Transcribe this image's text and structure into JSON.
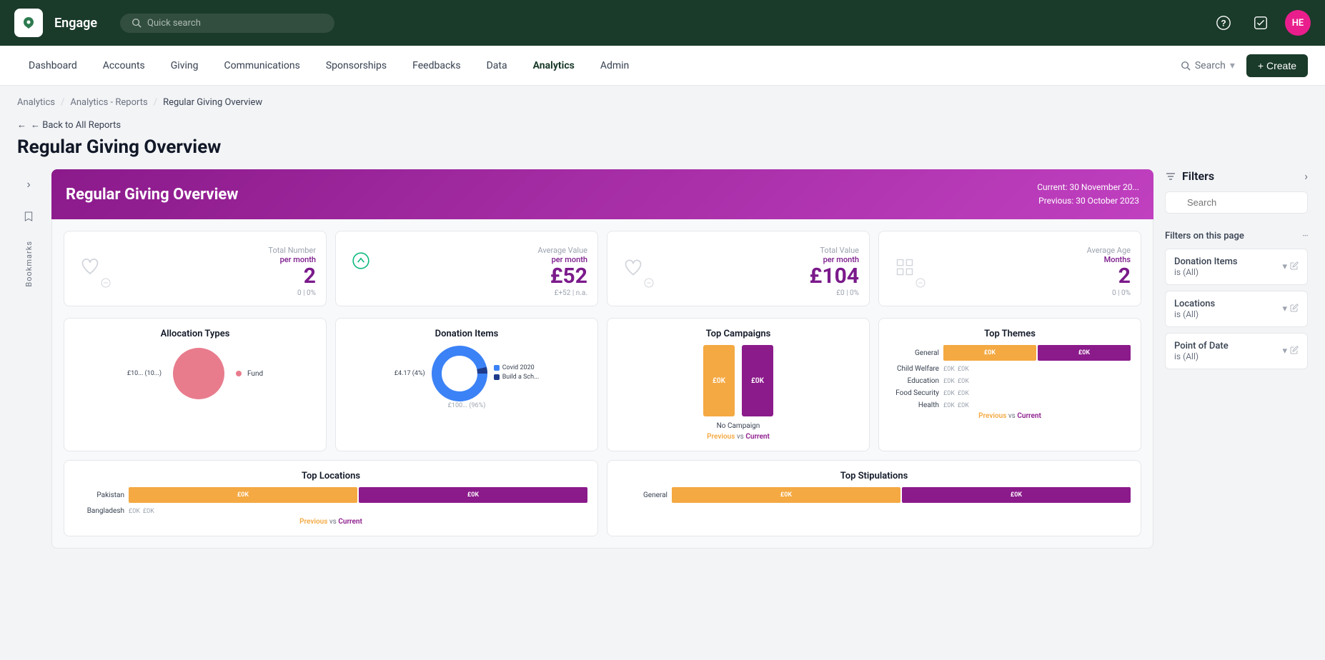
{
  "app": {
    "name": "Engage",
    "logo": "↺",
    "search_placeholder": "Quick search",
    "avatar_initials": "HE",
    "avatar_color": "#e91e8c"
  },
  "secondary_nav": {
    "items": [
      {
        "label": "Dashboard",
        "active": false
      },
      {
        "label": "Accounts",
        "active": false
      },
      {
        "label": "Giving",
        "active": false
      },
      {
        "label": "Communications",
        "active": false
      },
      {
        "label": "Sponsorships",
        "active": false
      },
      {
        "label": "Feedbacks",
        "active": false
      },
      {
        "label": "Data",
        "active": false
      },
      {
        "label": "Analytics",
        "active": true
      },
      {
        "label": "Admin",
        "active": false
      }
    ],
    "search_label": "Search",
    "create_label": "+ Create"
  },
  "breadcrumb": {
    "items": [
      {
        "label": "Analytics",
        "link": true
      },
      {
        "label": "Analytics - Reports",
        "link": true
      },
      {
        "label": "Regular Giving Overview",
        "link": false
      }
    ]
  },
  "page": {
    "back_label": "← Back to All Reports",
    "title": "Regular Giving Overview"
  },
  "report": {
    "banner_title": "Regular Giving Overview",
    "current_date": "Current:  30 November 20...",
    "previous_date": "Previous: 30 October 2023",
    "stats": [
      {
        "label": "Total Number",
        "sub_label": "per month",
        "value": "2",
        "footer": "0  |  0%",
        "icon": "♡"
      },
      {
        "label": "Average Value",
        "sub_label": "per month",
        "value": "£52",
        "footer": "£+52  |  n.a.",
        "icon": "↑",
        "trend_up": true
      },
      {
        "label": "Total Value",
        "sub_label": "per month",
        "value": "£104",
        "footer": "£0  |  0%",
        "icon": "♡"
      },
      {
        "label": "Average Age",
        "sub_label": "Months",
        "value": "2",
        "footer": "0  |  0%",
        "icon": "≡"
      }
    ],
    "top_campaigns": {
      "title": "Top Campaigns",
      "rows": [
        {
          "label": "No Campaign",
          "prev_val": "£0K",
          "curr_val": "£0K",
          "prev_h": 80,
          "curr_h": 80
        }
      ],
      "footer": "Previous vs Current"
    },
    "top_themes": {
      "title": "Top Themes",
      "rows": [
        {
          "label": "General",
          "prev": "£0K",
          "curr": "£0K"
        },
        {
          "label": "Child Welfare",
          "prev": "£0K",
          "curr": "£0K"
        },
        {
          "label": "Education",
          "prev": "£0K",
          "curr": "£0K"
        },
        {
          "label": "Food Security",
          "prev": "£0K",
          "curr": "£0K"
        },
        {
          "label": "Health",
          "prev": "£0K",
          "curr": "£0K"
        }
      ],
      "footer": "Previous vs Current"
    },
    "allocation_types": {
      "title": "Allocation Types",
      "legend": [
        {
          "label": "Fund",
          "color": "#e87c8d"
        }
      ],
      "pie_label": "£10... (10...)"
    },
    "donation_items": {
      "title": "Donation Items",
      "items": [
        {
          "label": "Covid 2020",
          "color": "#3b82f6",
          "value": "£4.17 (4%)"
        },
        {
          "label": "Build a Sch...",
          "color": "#1e40af"
        }
      ],
      "center_label": "£100... (96%)"
    },
    "top_locations": {
      "title": "Top Locations",
      "rows": [
        {
          "label": "Pakistan",
          "prev": "£0K",
          "curr": "£0K"
        },
        {
          "label": "Bangladesh",
          "prev": "£0K",
          "curr": "£0K"
        }
      ],
      "footer": "Previous vs Current"
    },
    "top_stipulations": {
      "title": "Top Stipulations",
      "rows": [
        {
          "label": "General",
          "prev": "£0K",
          "curr": "£0K"
        }
      ],
      "footer": ""
    }
  },
  "filters": {
    "title": "Filters",
    "search_placeholder": "Search",
    "on_page_label": "Filters on this page",
    "groups": [
      {
        "name": "Donation Items",
        "value_line1": "is (All)"
      },
      {
        "name": "Locations",
        "value_line1": "is (All)"
      },
      {
        "name": "Point of Date",
        "value_line1": "is (All)"
      }
    ]
  }
}
